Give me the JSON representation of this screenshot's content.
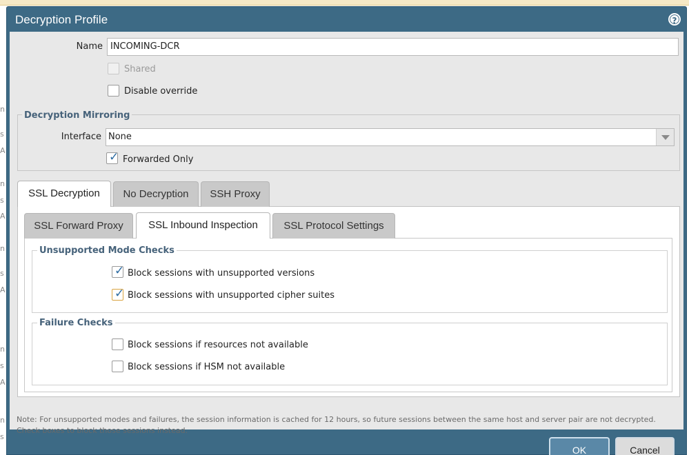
{
  "background": {
    "fragments": [
      "n",
      "s",
      "A",
      "n",
      "s",
      "A",
      "n",
      "s",
      "A",
      "n",
      "s",
      "A",
      "n",
      "s"
    ]
  },
  "dialog": {
    "title": "Decryption Profile",
    "help_icon": "?"
  },
  "form": {
    "name_label": "Name",
    "name_value": "INCOMING-DCR",
    "shared_label": "Shared",
    "shared_checked": false,
    "disable_override_label": "Disable override",
    "disable_override_checked": false
  },
  "mirroring": {
    "legend": "Decryption Mirroring",
    "interface_label": "Interface",
    "interface_value": "None",
    "forwarded_only_label": "Forwarded Only",
    "forwarded_only_checked": true
  },
  "tabs": [
    {
      "label": "SSL Decryption",
      "active": true
    },
    {
      "label": "No Decryption",
      "active": false
    },
    {
      "label": "SSH Proxy",
      "active": false
    }
  ],
  "subtabs": [
    {
      "label": "SSL Forward Proxy",
      "active": false
    },
    {
      "label": "SSL Inbound Inspection",
      "active": true
    },
    {
      "label": "SSL Protocol Settings",
      "active": false
    }
  ],
  "unsupported": {
    "legend": "Unsupported Mode Checks",
    "items": [
      {
        "label": "Block sessions with unsupported versions",
        "checked": true
      },
      {
        "label": "Block sessions with unsupported cipher suites",
        "checked": true
      }
    ]
  },
  "failure": {
    "legend": "Failure Checks",
    "items": [
      {
        "label": "Block sessions if resources not available",
        "checked": false
      },
      {
        "label": "Block sessions if HSM not available",
        "checked": false
      }
    ]
  },
  "note": "Note: For unsupported modes and failures, the session information is cached for 12 hours, so future sessions between the same host and server pair are not decrypted. Check boxes to block those sessions instead.",
  "buttons": {
    "ok": "OK",
    "cancel": "Cancel"
  },
  "colors": {
    "titlebar": "#3d6a85",
    "body": "#e8e8e8",
    "legend": "#46627a",
    "check": "#2d6ca2",
    "ok_button": "#5a88a7"
  }
}
